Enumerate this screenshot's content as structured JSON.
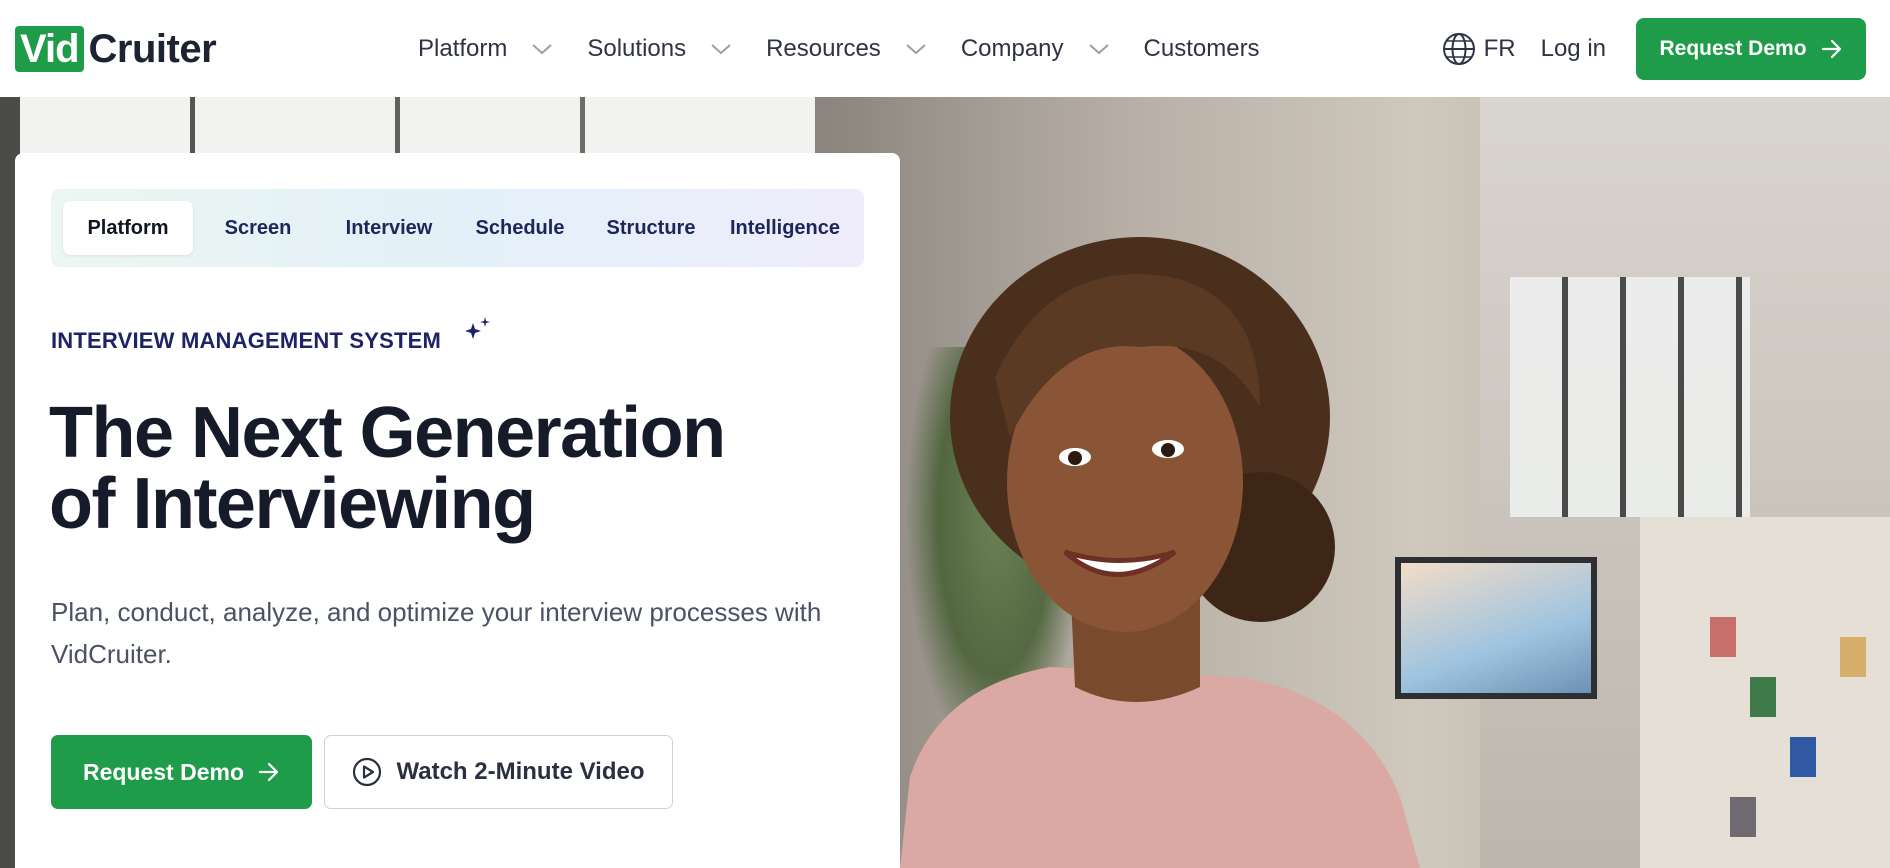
{
  "brand": {
    "logo_box": "Vid",
    "logo_text": "Cruiter"
  },
  "nav": {
    "items": [
      {
        "label": "Platform",
        "has_dropdown": true
      },
      {
        "label": "Solutions",
        "has_dropdown": true
      },
      {
        "label": "Resources",
        "has_dropdown": true
      },
      {
        "label": "Company",
        "has_dropdown": true
      },
      {
        "label": "Customers",
        "has_dropdown": false
      }
    ],
    "lang": "FR",
    "login": "Log in",
    "cta": "Request Demo"
  },
  "hero": {
    "tabs": [
      "Platform",
      "Screen",
      "Interview",
      "Schedule",
      "Structure",
      "Intelligence"
    ],
    "active_tab": "Platform",
    "eyebrow": "INTERVIEW MANAGEMENT SYSTEM",
    "headline_line1": "The Next Generation",
    "headline_line2": "of Interviewing",
    "subtext": "Plan, conduct, analyze, and optimize your interview processes with VidCruiter.",
    "primary_cta": "Request Demo",
    "secondary_cta": "Watch 2-Minute Video"
  },
  "icons": {
    "globe": "globe-icon",
    "arrow": "arrow-right-icon",
    "play": "play-circle-icon",
    "chevron": "chevron-down-icon",
    "sparkle": "sparkle-icon"
  },
  "colors": {
    "brand_green": "#1f9c4a",
    "navy": "#1d2366",
    "text_dark": "#161b2a"
  }
}
